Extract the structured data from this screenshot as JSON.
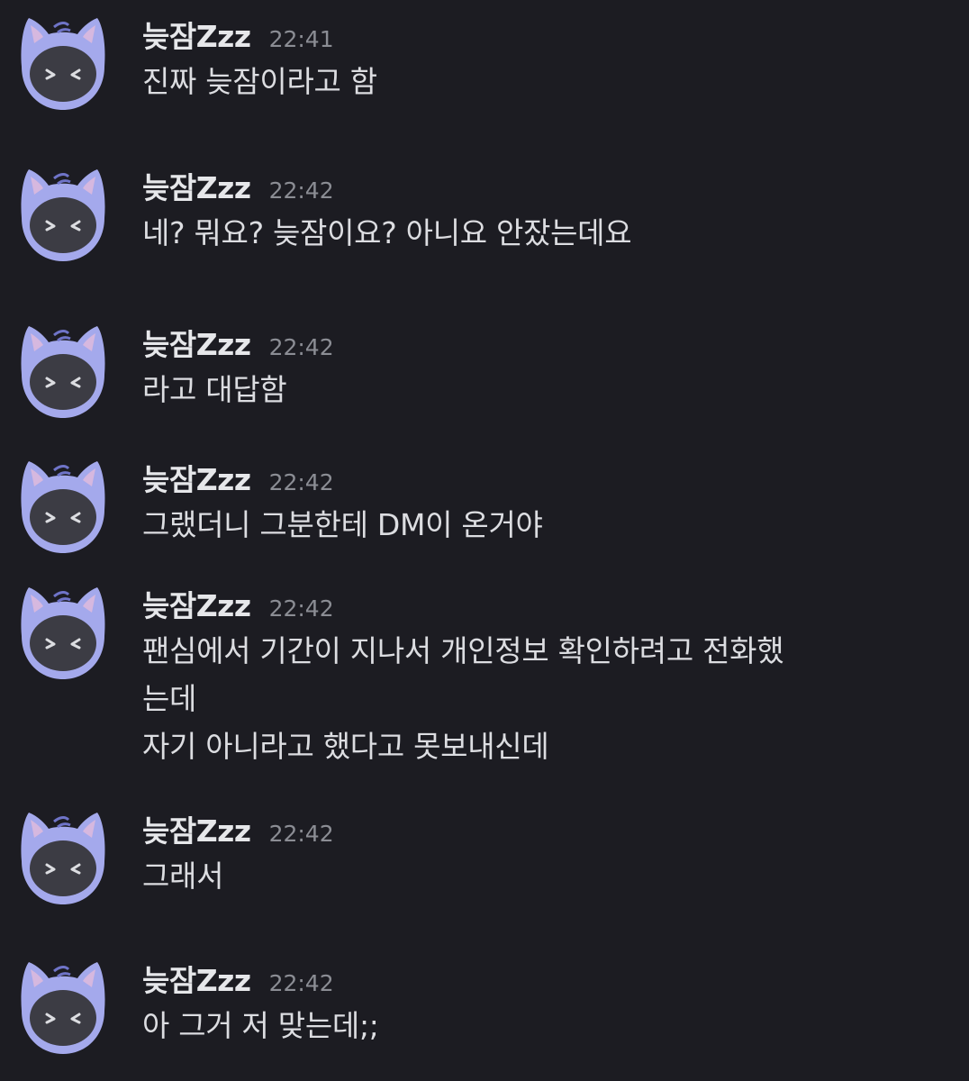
{
  "messages": [
    {
      "author": "늦잠Zzz",
      "time": "22:41",
      "lines": [
        "진짜 늦잠이라고 함"
      ]
    },
    {
      "author": "늦잠Zzz",
      "time": "22:42",
      "lines": [
        "네? 뭐요? 늦잠이요? 아니요 안잤는데요"
      ]
    },
    {
      "author": "늦잠Zzz",
      "time": "22:42",
      "lines": [
        "라고 대답함"
      ]
    },
    {
      "author": "늦잠Zzz",
      "time": "22:42",
      "lines": [
        "그랬더니 그분한테 DM이 온거야"
      ]
    },
    {
      "author": "늦잠Zzz",
      "time": "22:42",
      "lines": [
        "팬심에서 기간이 지나서 개인정보 확인하려고 전화했",
        "는데",
        "자기 아니라고 했다고 못보내신데"
      ]
    },
    {
      "author": "늦잠Zzz",
      "time": "22:42",
      "lines": [
        "그래서"
      ]
    },
    {
      "author": "늦잠Zzz",
      "time": "22:42",
      "lines": [
        "아 그거 저 맞는데;;"
      ]
    }
  ],
  "colors": {
    "background": "#1c1c22",
    "avatar_ring": "#a4a9ec",
    "avatar_face": "#3c3c44",
    "text": "#dcdde1",
    "timestamp": "#8b8d94"
  },
  "icons": {
    "avatar": "cat-face-avatar-icon"
  }
}
